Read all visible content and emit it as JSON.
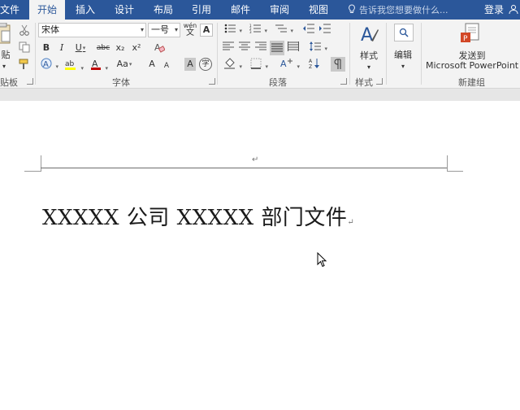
{
  "tabs": [
    "文件",
    "开始",
    "插入",
    "设计",
    "布局",
    "引用",
    "邮件",
    "审阅",
    "视图"
  ],
  "active_tab": "开始",
  "tell_me": "告诉我您想要做什么...",
  "login": "登录",
  "clipboard": {
    "paste_label": "贴",
    "group": "贴板"
  },
  "font": {
    "name": "宋体",
    "size": "一号",
    "pinyin_top": "wén",
    "pinyin_bottom": "文",
    "border_char": "A",
    "bold": "B",
    "italic": "I",
    "underline": "U",
    "strike": "abc",
    "subscript": "x₂",
    "superscript": "x²",
    "case": "Aa",
    "grow": "A",
    "shrink": "A",
    "char_shade": "A",
    "enclose": "字",
    "group": "字体"
  },
  "paragraph": {
    "group": "段落"
  },
  "styles": {
    "label": "样式",
    "group": "样式"
  },
  "editing": {
    "label": "编辑"
  },
  "newgroup": {
    "line1": "发送到",
    "line2": "Microsoft PowerPoint",
    "group": "新建组"
  },
  "document": {
    "text": "XXXXX 公司 XXXXX 部门文件",
    "para_mark": "↵",
    "header_mark": "↵"
  },
  "colors": {
    "ribbon_tab_bar": "#2b579a",
    "font_color_bar": "#c00000",
    "highlight_bar": "#ffff00"
  }
}
